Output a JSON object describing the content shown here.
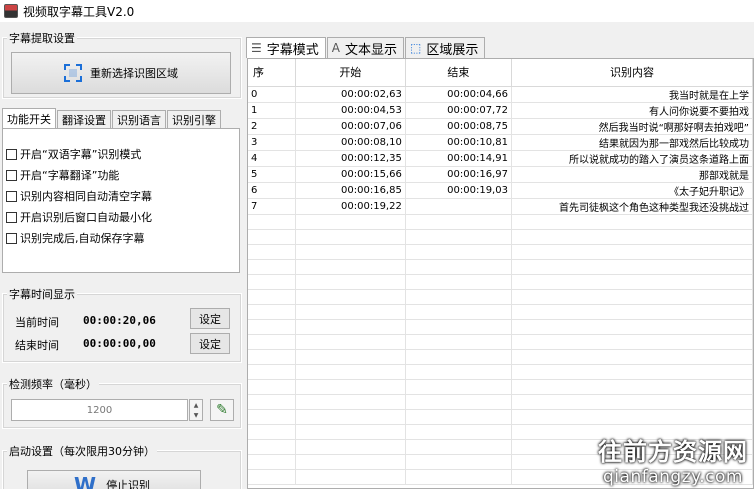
{
  "window": {
    "title": "视频取字幕工具V2.0"
  },
  "extract_settings": {
    "group_title": "字幕提取设置",
    "reselect_button": "重新选择识图区域"
  },
  "left_tabs": [
    "功能开关",
    "翻译设置",
    "识别语言",
    "识别引擎"
  ],
  "options": [
    "开启“双语字幕”识别模式",
    "开启“字幕翻译”功能",
    "识别内容相同自动清空字幕",
    "开启识别后窗口自动最小化",
    "识别完成后,自动保存字幕"
  ],
  "time_display": {
    "group_title": "字幕时间显示",
    "current_label": "当前时间",
    "current_value": "00:00:20,06",
    "end_label": "结束时间",
    "end_value": "00:00:00,00",
    "set_button": "设定"
  },
  "frequency": {
    "group_title": "检测频率（毫秒）",
    "value": "1200"
  },
  "startup": {
    "group_title": "启动设置（每次限用30分钟）",
    "stop_button": "停止识别"
  },
  "right_tabs": [
    "字幕模式",
    "文本显示",
    "区域展示"
  ],
  "table": {
    "headers": [
      "序",
      "开始",
      "结束",
      "识别内容"
    ],
    "rows": [
      [
        "0",
        "00:00:02,63",
        "00:00:04,66",
        "我当时就是在上学"
      ],
      [
        "1",
        "00:00:04,53",
        "00:00:07,72",
        "有人问你说要不要拍戏"
      ],
      [
        "2",
        "00:00:07,06",
        "00:00:08,75",
        "然后我当时说“啊那好啊去拍戏吧”"
      ],
      [
        "3",
        "00:00:08,10",
        "00:00:10,81",
        "结果就因为那一部戏然后比较成功"
      ],
      [
        "4",
        "00:00:12,35",
        "00:00:14,91",
        "所以说就成功的踏入了演员这条道路上面"
      ],
      [
        "5",
        "00:00:15,66",
        "00:00:16,97",
        "那部戏就是"
      ],
      [
        "6",
        "00:00:16,85",
        "00:00:19,03",
        "《太子妃升职记》"
      ],
      [
        "7",
        "00:00:19,22",
        "",
        "首先司徒枫这个角色这种类型我还没挑战过"
      ]
    ]
  },
  "watermark": {
    "title": "往前方资源网",
    "url": "qianfangzy.com"
  },
  "icons": {
    "app": "app-icon",
    "select_region": "select-region-icon",
    "edit": "edit-icon",
    "tab_list": "list-icon",
    "tab_text": "text-icon",
    "tab_region": "region-icon",
    "stop": "w-logo-icon"
  }
}
